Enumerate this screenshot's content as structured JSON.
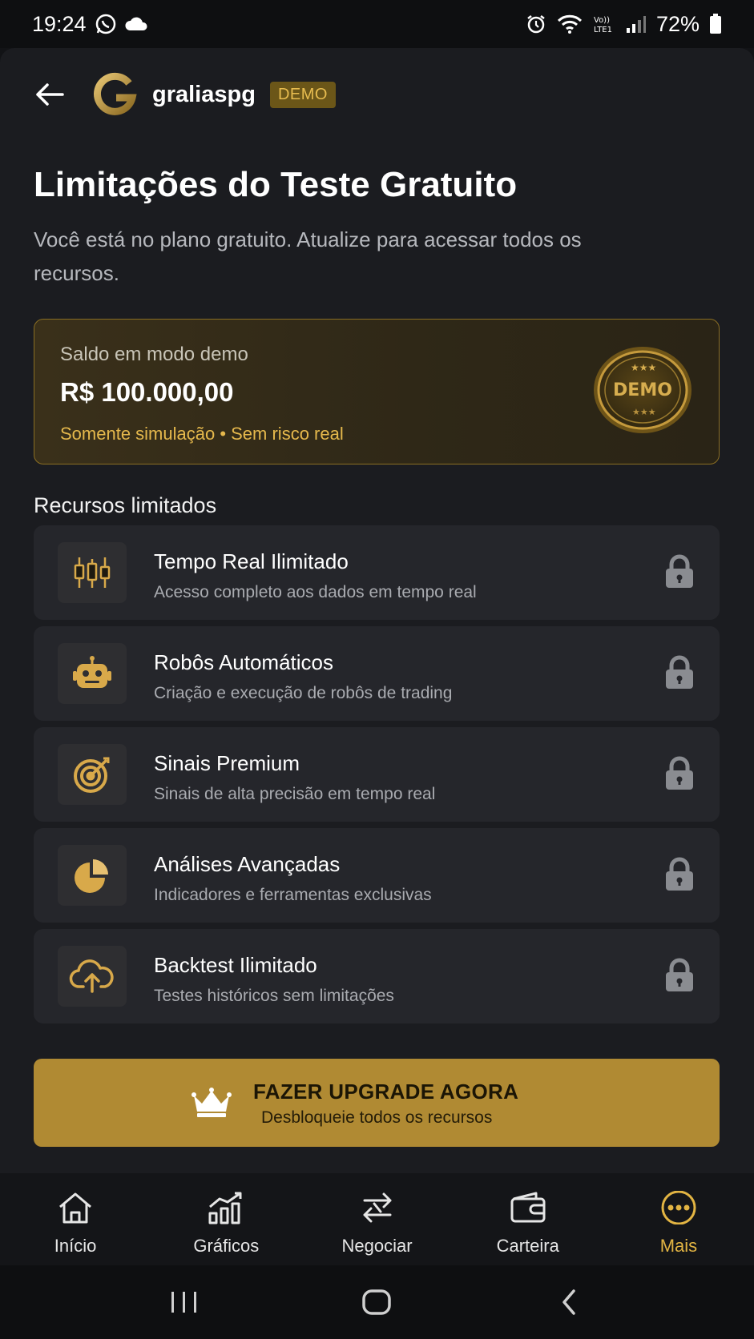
{
  "status_bar": {
    "time": "19:24",
    "battery": "72%"
  },
  "header": {
    "brand": "graliaspg",
    "badge": "DEMO"
  },
  "page": {
    "title": "Limitações do Teste Gratuito",
    "subtitle": "Você está no plano gratuito. Atualize para acessar todos os recursos."
  },
  "balance_card": {
    "label": "Saldo em modo demo",
    "value": "R$ 100.000,00",
    "note": "Somente simulação • Sem risco real",
    "seal_text": "DEMO"
  },
  "features": {
    "section_title": "Recursos limitados",
    "items": [
      {
        "title": "Tempo Real Ilimitado",
        "desc": "Acesso completo aos dados em tempo real",
        "icon": "candlestick-chart-icon"
      },
      {
        "title": "Robôs Automáticos",
        "desc": "Criação e execução de robôs de trading",
        "icon": "robot-icon"
      },
      {
        "title": "Sinais Premium",
        "desc": "Sinais de alta precisão em tempo real",
        "icon": "target-icon"
      },
      {
        "title": "Análises Avançadas",
        "desc": "Indicadores e ferramentas exclusivas",
        "icon": "pie-chart-icon"
      },
      {
        "title": "Backtest Ilimitado",
        "desc": "Testes históricos sem limitações",
        "icon": "cloud-upload-icon"
      }
    ]
  },
  "upgrade": {
    "title": "FAZER UPGRADE AGORA",
    "subtitle": "Desbloqueie todos os recursos"
  },
  "bottom_nav": {
    "items": [
      {
        "label": "Início",
        "icon": "home-icon"
      },
      {
        "label": "Gráficos",
        "icon": "chart-icon"
      },
      {
        "label": "Negociar",
        "icon": "exchange-icon"
      },
      {
        "label": "Carteira",
        "icon": "wallet-icon"
      },
      {
        "label": "Mais",
        "icon": "more-icon"
      }
    ],
    "active": "Mais"
  },
  "colors": {
    "accent_gold": "#e2b443",
    "button_gold": "#b08a33",
    "background": "#1b1c20",
    "card": "#25262b"
  }
}
